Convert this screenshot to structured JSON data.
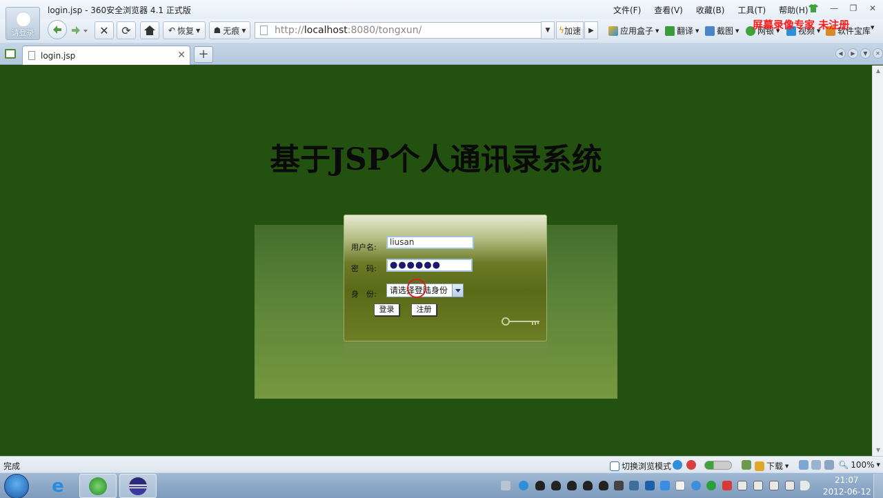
{
  "window": {
    "title": "login.jsp - 360安全浏览器 4.1 正式版",
    "avatar_label": "请登录"
  },
  "menu": [
    "文件(F)",
    "查看(V)",
    "收藏(B)",
    "工具(T)",
    "帮助(H)"
  ],
  "toolbar": {
    "restore_label": "恢复",
    "incognito_label": "无痕",
    "url_prefix": "http://",
    "url_host": "localhost",
    "url_suffix": ":8080/tongxun/",
    "accelerate_label": "加速",
    "app_box_label": "应用盒子",
    "translate_label": "翻译",
    "screenshot_label": "截图",
    "netbank_label": "网银",
    "video_label": "视频",
    "software_label": "软件宝库"
  },
  "watermark": "屏幕录像专家 未注册",
  "tab": {
    "title": "login.jsp"
  },
  "page": {
    "heading": "基于JSP个人通讯录系统",
    "form": {
      "username_label": "用户名:",
      "username_value": "liusan",
      "password_label": "密　码:",
      "password_value": "●●●●●●",
      "role_label": "身　份:",
      "role_selected": "请选择登陆身份",
      "login_button": "登录",
      "register_button": "注册"
    }
  },
  "statusbar": {
    "status": "完成",
    "switch_mode": "切换浏览模式",
    "download": "下载",
    "zoom": "100%"
  },
  "taskbar": {
    "time": "21:07",
    "date": "2012-06-12"
  },
  "colors": {
    "page_background": "#23510f",
    "watermark": "#ff1a1a"
  }
}
